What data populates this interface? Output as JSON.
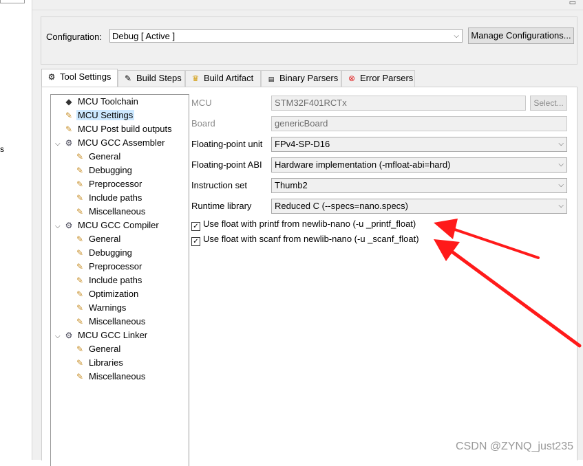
{
  "left_fragment": "s",
  "config": {
    "label": "Configuration:",
    "value": "Debug  [ Active ]",
    "manage_button": "Manage Configurations..."
  },
  "tabs": [
    {
      "label": "Tool Settings",
      "icon": "gear-icon",
      "active": true
    },
    {
      "label": "Build Steps",
      "icon": "tool-icon",
      "active": false
    },
    {
      "label": "Build Artifact",
      "icon": "trophy-icon",
      "active": false
    },
    {
      "label": "Binary Parsers",
      "icon": "binary-icon",
      "active": false
    },
    {
      "label": "Error Parsers",
      "icon": "error-icon",
      "active": false
    }
  ],
  "tree": [
    {
      "label": "MCU Toolchain",
      "level": 0,
      "toggle": "",
      "icon": "chip-icon",
      "selected": false
    },
    {
      "label": "MCU Settings",
      "level": 0,
      "toggle": "",
      "icon": "settings-icon",
      "selected": true
    },
    {
      "label": "MCU Post build outputs",
      "level": 0,
      "toggle": "",
      "icon": "settings-icon",
      "selected": false
    },
    {
      "label": "MCU GCC Assembler",
      "level": 0,
      "toggle": "v",
      "icon": "gear-icon",
      "selected": false
    },
    {
      "label": "General",
      "level": 1,
      "toggle": "",
      "icon": "settings-icon",
      "selected": false
    },
    {
      "label": "Debugging",
      "level": 1,
      "toggle": "",
      "icon": "settings-icon",
      "selected": false
    },
    {
      "label": "Preprocessor",
      "level": 1,
      "toggle": "",
      "icon": "settings-icon",
      "selected": false
    },
    {
      "label": "Include paths",
      "level": 1,
      "toggle": "",
      "icon": "settings-icon",
      "selected": false
    },
    {
      "label": "Miscellaneous",
      "level": 1,
      "toggle": "",
      "icon": "settings-icon",
      "selected": false
    },
    {
      "label": "MCU GCC Compiler",
      "level": 0,
      "toggle": "v",
      "icon": "gear-icon",
      "selected": false
    },
    {
      "label": "General",
      "level": 1,
      "toggle": "",
      "icon": "settings-icon",
      "selected": false
    },
    {
      "label": "Debugging",
      "level": 1,
      "toggle": "",
      "icon": "settings-icon",
      "selected": false
    },
    {
      "label": "Preprocessor",
      "level": 1,
      "toggle": "",
      "icon": "settings-icon",
      "selected": false
    },
    {
      "label": "Include paths",
      "level": 1,
      "toggle": "",
      "icon": "settings-icon",
      "selected": false
    },
    {
      "label": "Optimization",
      "level": 1,
      "toggle": "",
      "icon": "settings-icon",
      "selected": false
    },
    {
      "label": "Warnings",
      "level": 1,
      "toggle": "",
      "icon": "settings-icon",
      "selected": false
    },
    {
      "label": "Miscellaneous",
      "level": 1,
      "toggle": "",
      "icon": "settings-icon",
      "selected": false
    },
    {
      "label": "MCU GCC Linker",
      "level": 0,
      "toggle": "v",
      "icon": "gear-icon",
      "selected": false
    },
    {
      "label": "General",
      "level": 1,
      "toggle": "",
      "icon": "settings-icon",
      "selected": false
    },
    {
      "label": "Libraries",
      "level": 1,
      "toggle": "",
      "icon": "settings-icon",
      "selected": false
    },
    {
      "label": "Miscellaneous",
      "level": 1,
      "toggle": "",
      "icon": "settings-icon",
      "selected": false
    }
  ],
  "settings": {
    "mcu": {
      "label": "MCU",
      "value": "STM32F401RCTx",
      "button": "Select..."
    },
    "board": {
      "label": "Board",
      "value": "genericBoard"
    },
    "fpu": {
      "label": "Floating-point unit",
      "value": "FPv4-SP-D16"
    },
    "fpabi": {
      "label": "Floating-point ABI",
      "value": "Hardware implementation (-mfloat-abi=hard)"
    },
    "iset": {
      "label": "Instruction set",
      "value": "Thumb2"
    },
    "runtime": {
      "label": "Runtime library",
      "value": "Reduced C (--specs=nano.specs)"
    },
    "printf_float": {
      "label": "Use float with printf from newlib-nano (-u _printf_float)",
      "checked": true
    },
    "scanf_float": {
      "label": "Use float with scanf from newlib-nano (-u _scanf_float)",
      "checked": true
    }
  },
  "watermark": "CSDN @ZYNQ_just235",
  "colors": {
    "arrow": "#ff1a1a",
    "selection": "#cce8ff"
  }
}
